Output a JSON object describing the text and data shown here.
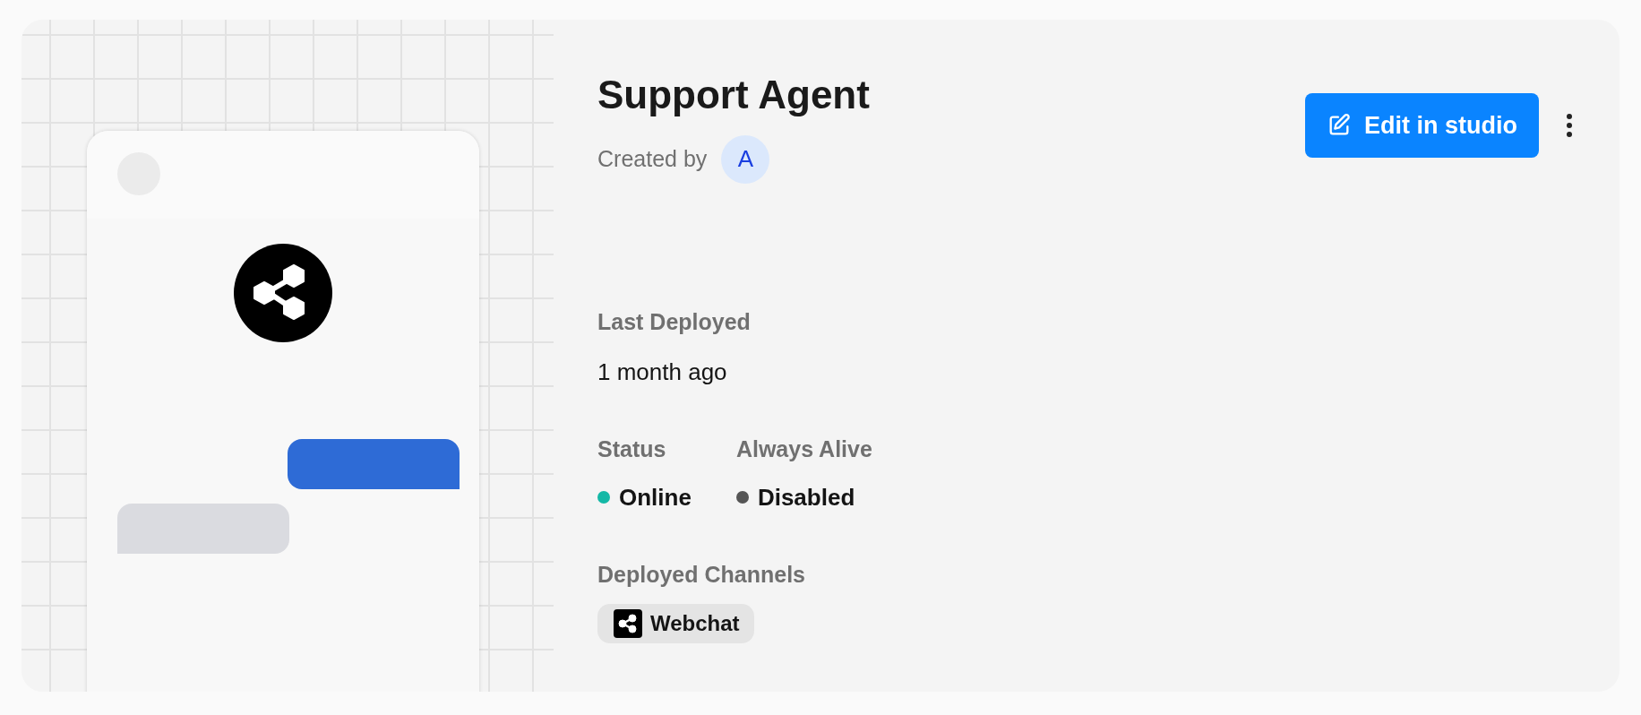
{
  "agent": {
    "title": "Support Agent",
    "created_by_label": "Created by",
    "creator_initial": "A"
  },
  "actions": {
    "edit_button": "Edit in studio"
  },
  "details": {
    "last_deployed": {
      "label": "Last Deployed",
      "value": "1 month ago"
    },
    "indicators": [
      {
        "label": "Status",
        "value": "Online",
        "color": "#14b8a6"
      },
      {
        "label": "Always Alive",
        "value": "Disabled",
        "color": "#555555"
      }
    ],
    "channels_label": "Deployed Channels",
    "channels": [
      {
        "name": "Webchat"
      }
    ]
  }
}
